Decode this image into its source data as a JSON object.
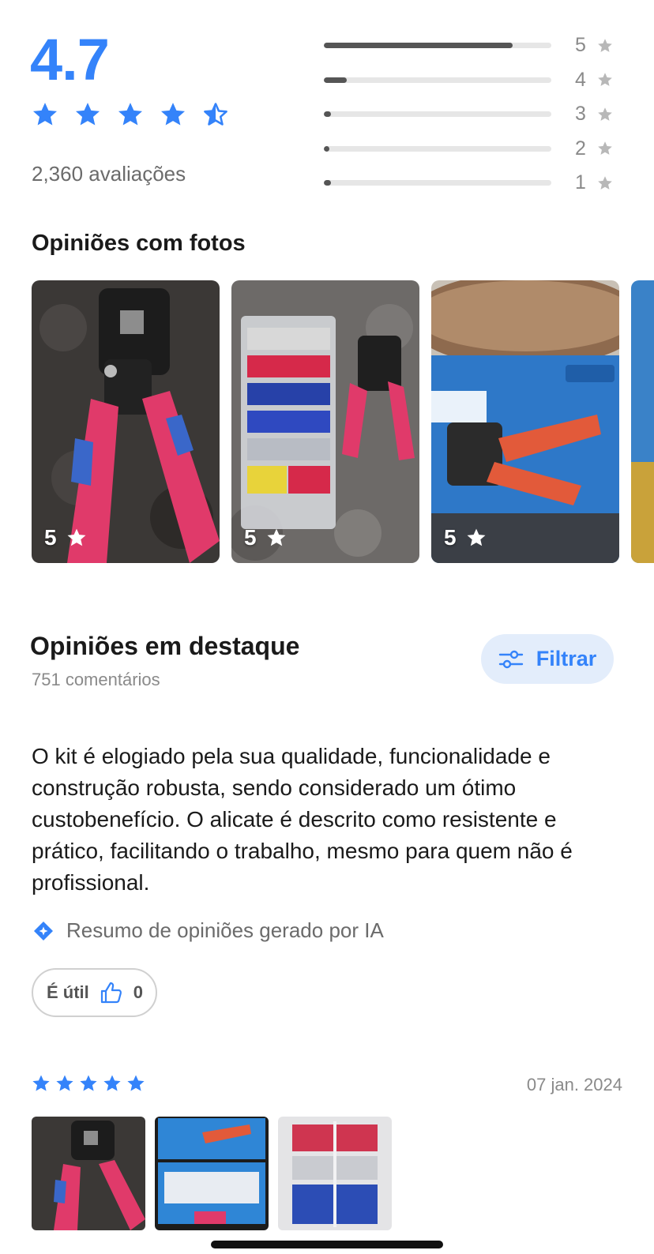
{
  "summary": {
    "score": "4.7",
    "stars_filled": 4.5,
    "total_label": "2,360 avaliações",
    "accent_color": "#3483fa",
    "distribution": [
      {
        "stars": "5",
        "fraction": 0.83
      },
      {
        "stars": "4",
        "fraction": 0.1
      },
      {
        "stars": "3",
        "fraction": 0.03
      },
      {
        "stars": "2",
        "fraction": 0.01
      },
      {
        "stars": "1",
        "fraction": 0.03
      }
    ]
  },
  "photos_section": {
    "title": "Opiniões com fotos",
    "photos": [
      {
        "rating": "5",
        "image": "crimping-plier-photo"
      },
      {
        "rating": "5",
        "image": "kit-box-and-plier-photo"
      },
      {
        "rating": "5",
        "image": "product-package-photo"
      }
    ]
  },
  "highlights": {
    "title": "Opiniões em destaque",
    "comments_count": "751 comentários",
    "filter_label": "Filtrar",
    "ai_summary": "O kit é elogiado pela sua qualidade, funcionalidade e construção robusta, sendo considerado um ótimo custobenefício. O alicate é descrito como resistente e prático, facilitando o trabalho, mesmo para quem não é profissional.",
    "ai_note": "Resumo de opiniões gerado por IA",
    "useful_label": "É útil",
    "useful_count": "0"
  },
  "review": {
    "stars": 5,
    "date": "07 jan. 2024",
    "thumbnails": [
      "plier-thumbnail",
      "box-thumbnail",
      "terminals-thumbnail"
    ]
  }
}
